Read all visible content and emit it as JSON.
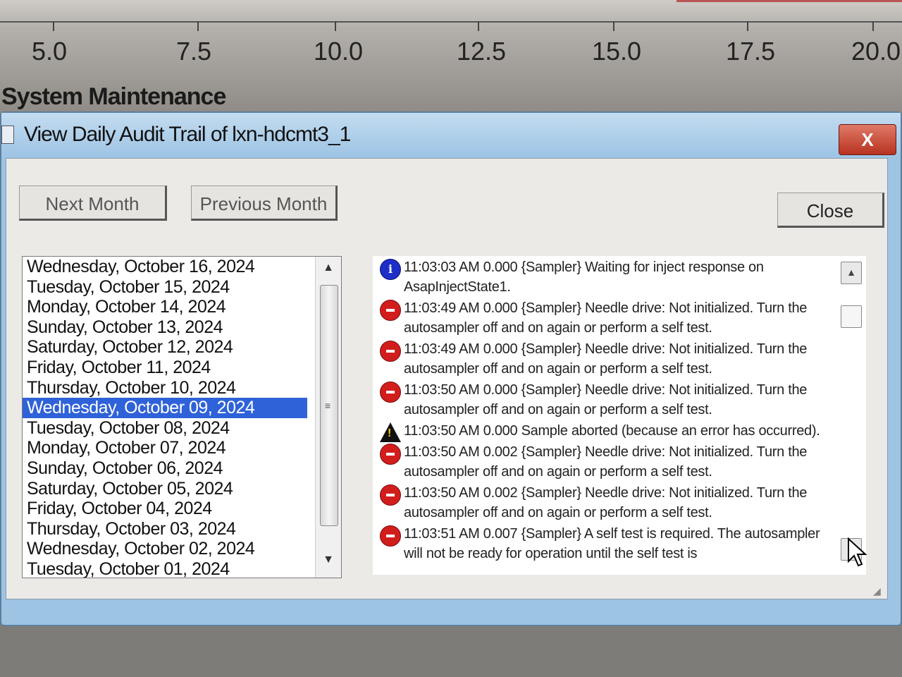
{
  "background": {
    "axis_ticks": [
      "5.0",
      "7.5",
      "10.0",
      "12.5",
      "15.0",
      "17.5",
      "20.0"
    ],
    "label": "System Maintenance"
  },
  "window": {
    "title": "View Daily Audit Trail of lxn-hdcmt3_1",
    "close_glyph": "X"
  },
  "buttons": {
    "next_month": "Next Month",
    "previous_month": "Previous Month",
    "close": "Close"
  },
  "dates": [
    "Wednesday, October 16, 2024",
    "Tuesday, October 15, 2024",
    "Monday, October 14, 2024",
    "Sunday, October 13, 2024",
    "Saturday, October 12, 2024",
    "Friday, October 11, 2024",
    "Thursday, October 10, 2024",
    "Wednesday, October 09, 2024",
    "Tuesday, October 08, 2024",
    "Monday, October 07, 2024",
    "Sunday, October 06, 2024",
    "Saturday, October 05, 2024",
    "Friday, October 04, 2024",
    "Thursday, October 03, 2024",
    "Wednesday, October 02, 2024",
    "Tuesday, October 01, 2024"
  ],
  "selected_date": "Wednesday, October 09, 2024",
  "log_entries": [
    {
      "type": "info",
      "icon": "info-icon",
      "text": "11:03:03 AM 0.000 {Sampler} Waiting for inject response on AsapInjectState1."
    },
    {
      "type": "error",
      "icon": "error-icon",
      "text": "11:03:49 AM 0.000 {Sampler} Needle drive: Not initialized. Turn the autosampler off and on again or perform a self test."
    },
    {
      "type": "error",
      "icon": "error-icon",
      "text": "11:03:49 AM 0.000 {Sampler} Needle drive: Not initialized. Turn the autosampler off and on again or perform a self test."
    },
    {
      "type": "error",
      "icon": "error-icon",
      "text": "11:03:50 AM 0.000 {Sampler} Needle drive: Not initialized. Turn the autosampler off and on again or perform a self test."
    },
    {
      "type": "warning",
      "icon": "warning-icon",
      "text": "11:03:50 AM 0.000 Sample aborted (because an error has occurred)."
    },
    {
      "type": "error",
      "icon": "error-icon",
      "text": "11:03:50 AM 0.002 {Sampler} Needle drive: Not initialized. Turn the autosampler off and on again or perform a self test."
    },
    {
      "type": "error",
      "icon": "error-icon",
      "text": "11:03:50 AM 0.002 {Sampler} Needle drive: Not initialized. Turn the autosampler off and on again or perform a self test."
    },
    {
      "type": "error",
      "icon": "error-icon",
      "text": "11:03:51 AM 0.007 {Sampler} A self test is required. The autosampler will not be ready for operation until the self test is"
    }
  ],
  "colors": {
    "selection": "#2f62d8",
    "error": "#d21d1d",
    "info": "#1d2fc6",
    "warning": "#f2d21b",
    "close_button": "#c9422e"
  }
}
